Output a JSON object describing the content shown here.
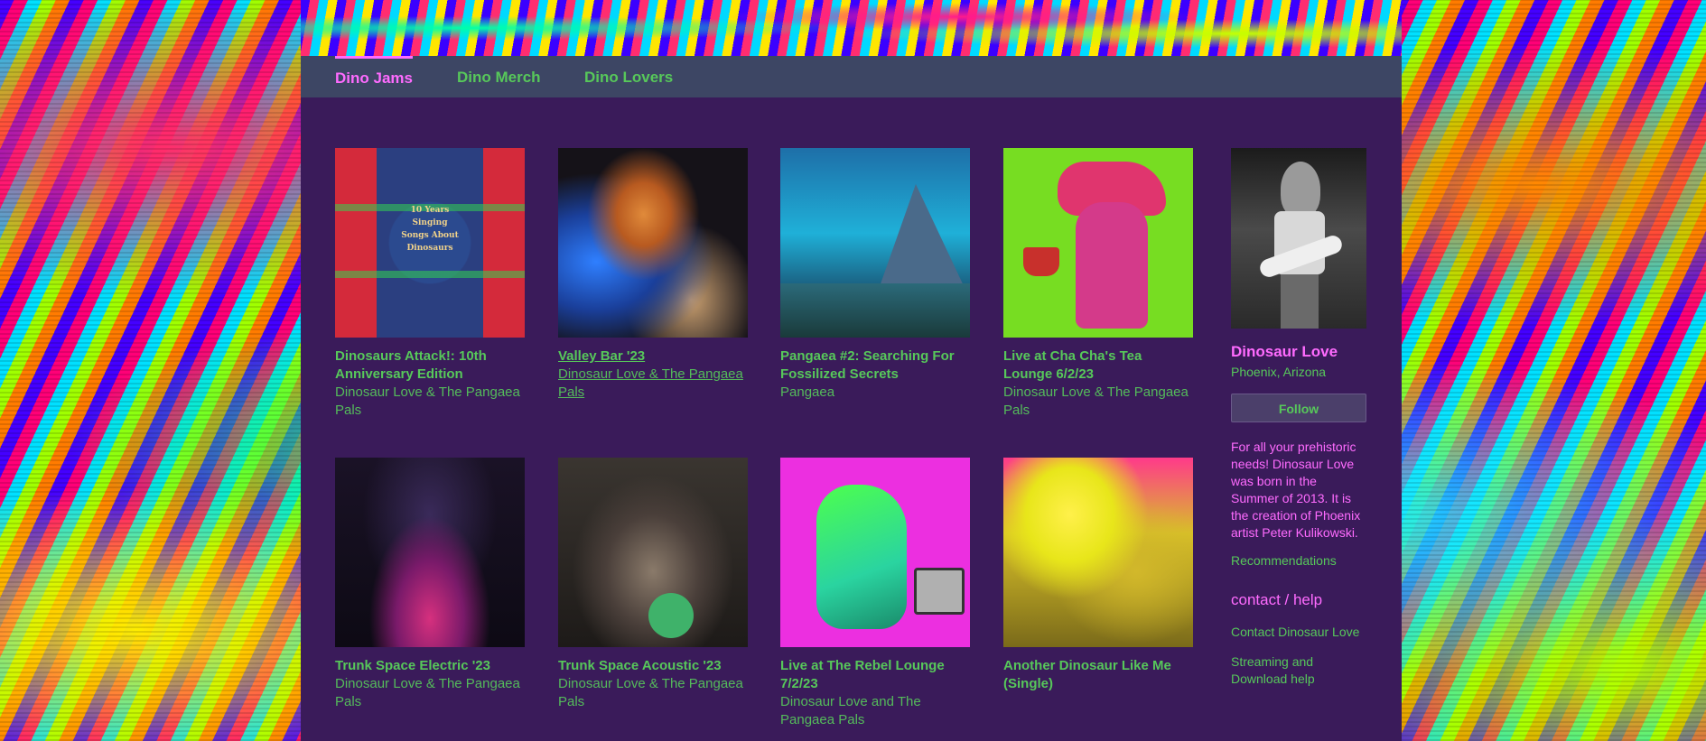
{
  "nav": {
    "tabs": [
      "Dino Jams",
      "Dino Merch",
      "Dino Lovers"
    ]
  },
  "releases": [
    {
      "title": "Dinosaurs Attack!: 10th Anniversary Edition",
      "artist": "Dinosaur Love & The Pangaea Pals",
      "cover_text": "10 Years Singing Songs About Dinosaurs"
    },
    {
      "title": "Valley Bar '23",
      "artist": "Dinosaur Love & The Pangaea Pals"
    },
    {
      "title": "Pangaea #2: Searching For Fossilized Secrets",
      "artist": "Pangaea"
    },
    {
      "title": "Live at Cha Cha's Tea Lounge 6/2/23",
      "artist": "Dinosaur Love & The Pangaea Pals"
    },
    {
      "title": "Trunk Space Electric '23",
      "artist": "Dinosaur Love & The Pangaea Pals"
    },
    {
      "title": "Trunk Space Acoustic '23",
      "artist": "Dinosaur Love & The Pangaea Pals"
    },
    {
      "title": "Live at The Rebel Lounge 7/2/23",
      "artist": "Dinosaur Love and The Pangaea Pals"
    },
    {
      "title": "Another Dinosaur Like Me (Single)",
      "artist": ""
    }
  ],
  "sidebar": {
    "name": "Dinosaur Love",
    "location": "Phoenix, Arizona",
    "follow_label": "Follow",
    "bio": "For all your prehistoric needs! Dinosaur Love was born in the Summer of 2013. It is the creation of Phoenix artist Peter Kulikowski.",
    "recommendations_label": "Recommendations",
    "contact_heading": "contact / help",
    "contact_link": "Contact Dinosaur Love",
    "streaming_link": "Streaming and Download help"
  }
}
